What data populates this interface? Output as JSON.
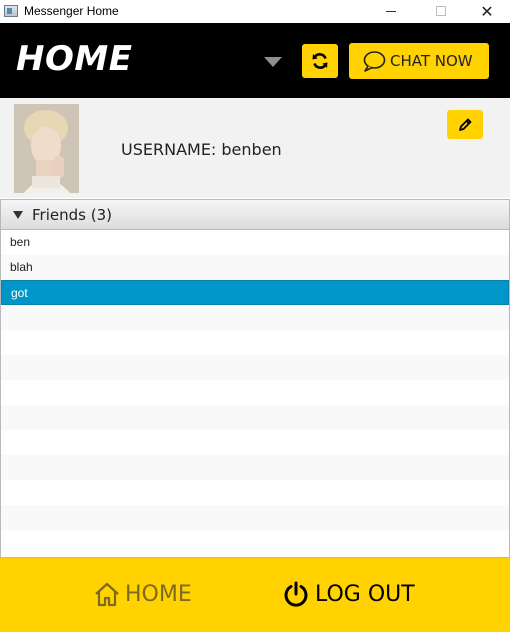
{
  "window": {
    "title": "Messenger Home",
    "minimize_glyph": "",
    "close_glyph": "✕"
  },
  "header": {
    "title": "HOME",
    "chat_button_label": "CHAT NOW"
  },
  "profile": {
    "username_text": "USERNAME: benben"
  },
  "friends": {
    "header_label": "Friends (3)",
    "items": [
      "ben",
      "blah",
      "got"
    ],
    "selected_index": 2
  },
  "bottom_nav": {
    "home_label": "HOME",
    "logout_label": "LOG OUT"
  },
  "icons": {
    "header": [
      "dropdown-arrow-icon",
      "refresh-icon",
      "chat-bubble-icon"
    ],
    "profile": [
      "pencil-icon"
    ],
    "bottom": [
      "home-icon",
      "power-icon"
    ]
  },
  "colors": {
    "accent": "#ffd200",
    "header_bg": "#000000",
    "selection": "#0096c9"
  }
}
